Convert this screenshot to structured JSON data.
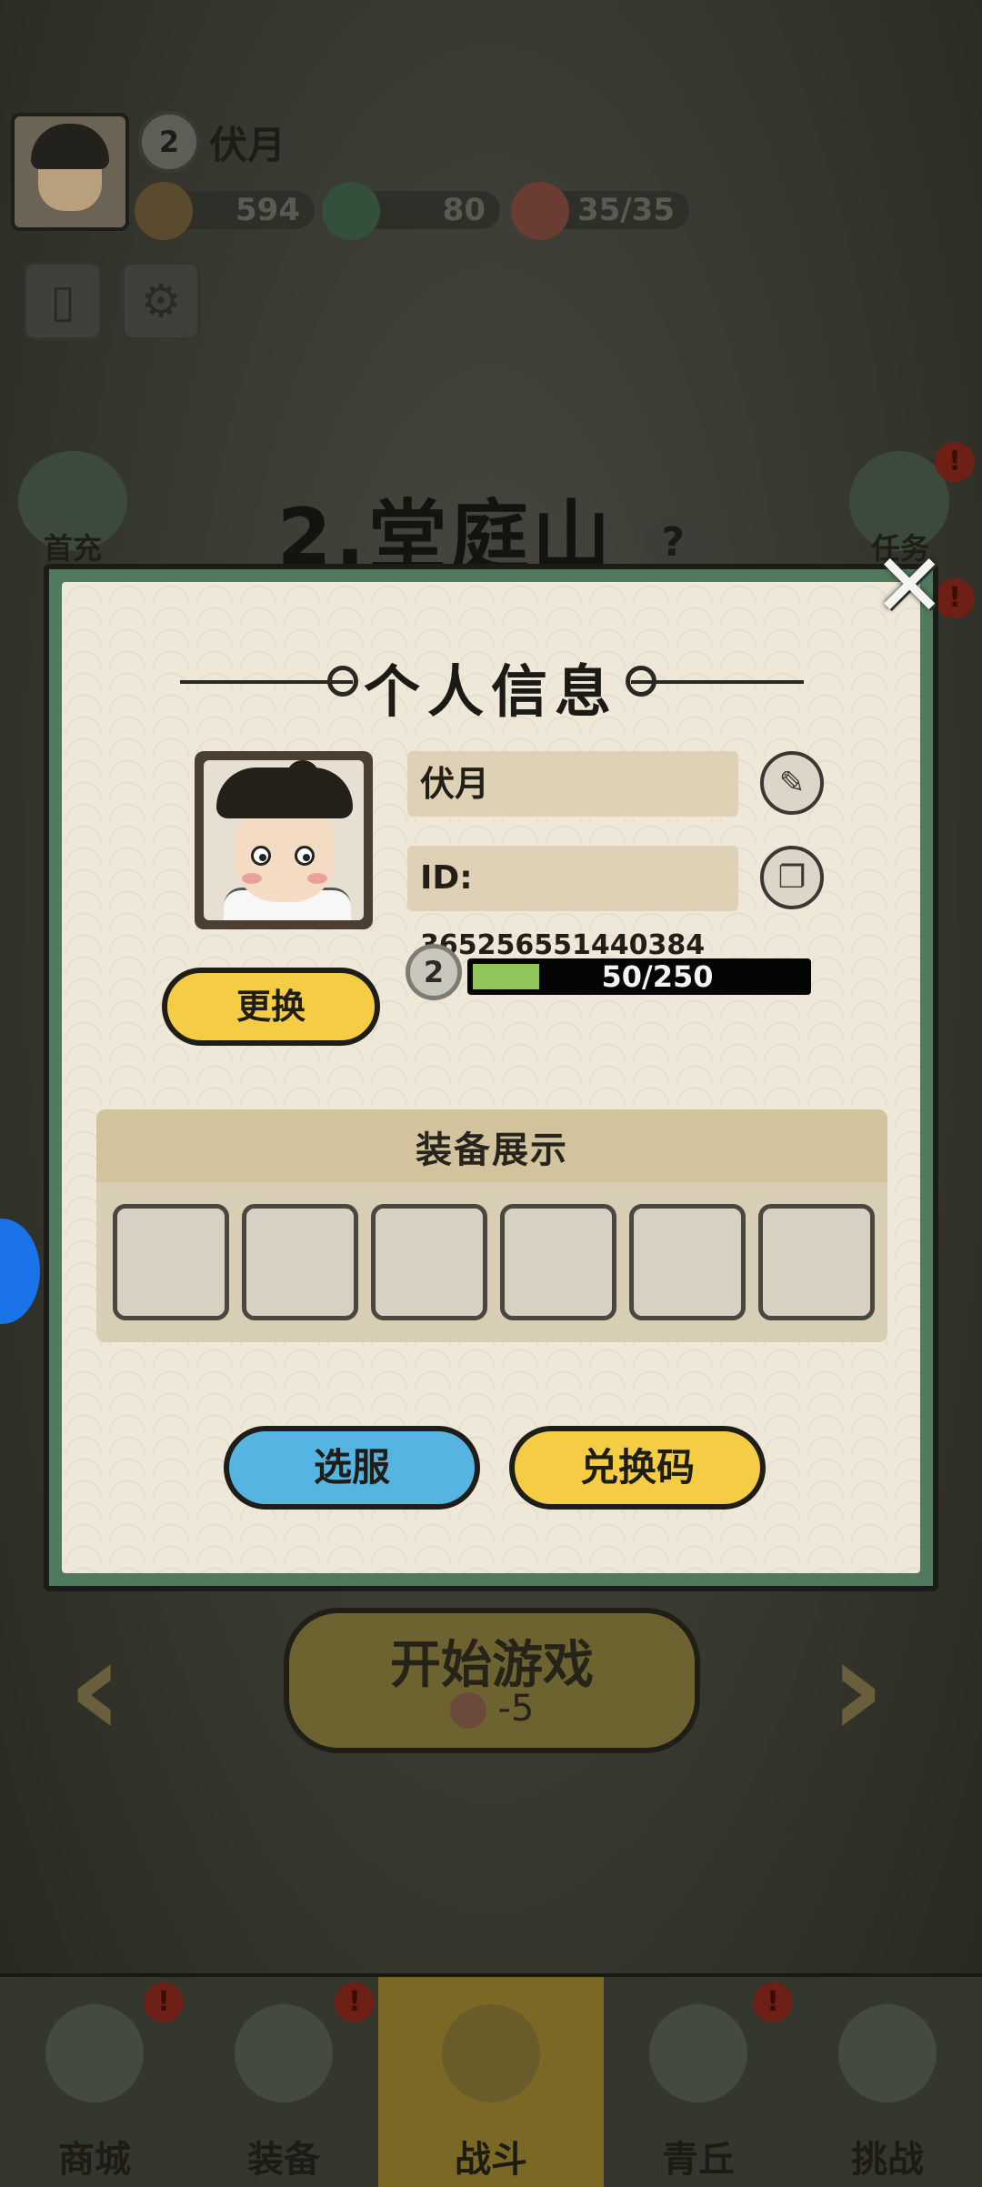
{
  "hud": {
    "player_level": "2",
    "player_name": "伏月",
    "coins": "594",
    "jade": "80",
    "stamina": "35/35"
  },
  "stage": {
    "title": "2.堂庭山",
    "help_icon": "?"
  },
  "side_buttons": {
    "first_charge_label": "首充",
    "tasks_label": "任务",
    "badge": "!"
  },
  "start_game": {
    "label": "开始游戏",
    "cost": "-5"
  },
  "bottom_nav": [
    {
      "label": "商城",
      "badge": "!"
    },
    {
      "label": "装备",
      "badge": "!"
    },
    {
      "label": "战斗",
      "badge": ""
    },
    {
      "label": "青丘",
      "badge": "!"
    },
    {
      "label": "挑战",
      "badge": ""
    }
  ],
  "modal": {
    "title": "个人信息",
    "name": "伏月",
    "id_prefix": "ID:",
    "id_value": "365256551440384",
    "level": "2",
    "xp_text": "50/250",
    "xp_progress": 0.2,
    "change_avatar_label": "更换",
    "equipment_title": "装备展示",
    "select_server_label": "选服",
    "redeem_code_label": "兑换码",
    "close_icon": "✕"
  },
  "colors": {
    "modal_border": "#507a5e",
    "yellow_button": "#f4cd45",
    "blue_button": "#56b4e2",
    "xp_fill": "#8fc55b"
  }
}
